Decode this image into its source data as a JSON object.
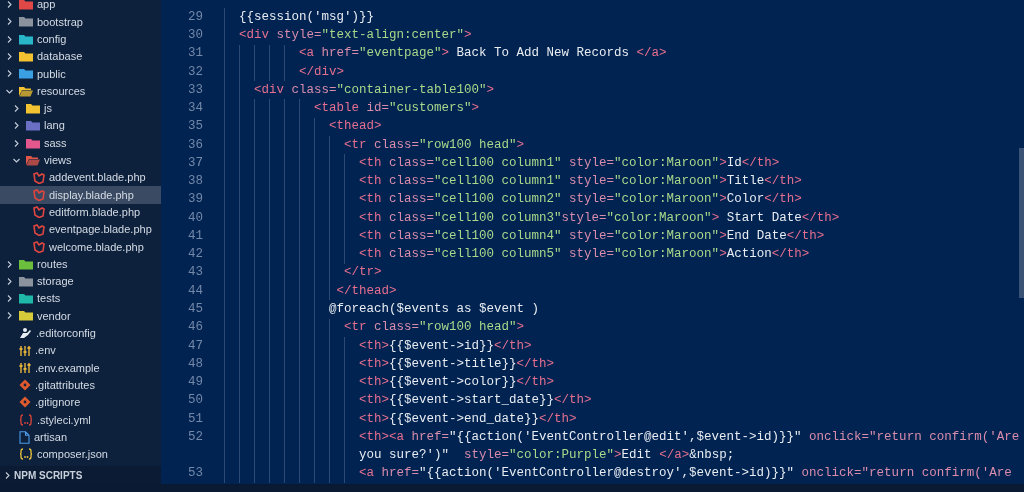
{
  "explorer": {
    "tree": [
      {
        "name": "app",
        "kind": "folder",
        "color": "#e04848",
        "expanded": false,
        "selected": false
      },
      {
        "name": "bootstrap",
        "kind": "folder",
        "color": "#8a939e",
        "expanded": false,
        "selected": false
      },
      {
        "name": "config",
        "kind": "folder",
        "color": "#29b6c9",
        "expanded": false,
        "selected": false
      },
      {
        "name": "database",
        "kind": "folder",
        "color": "#f2c230",
        "expanded": false,
        "selected": false
      },
      {
        "name": "public",
        "kind": "folder",
        "color": "#3b9fe3",
        "expanded": false,
        "selected": false
      },
      {
        "name": "resources",
        "kind": "folder",
        "color": "#f2c230",
        "expanded": true,
        "selected": false,
        "children": [
          {
            "name": "js",
            "kind": "folder",
            "color": "#f2c230",
            "expanded": false,
            "selected": false
          },
          {
            "name": "lang",
            "kind": "folder",
            "color": "#6b6fc4",
            "expanded": false,
            "selected": false
          },
          {
            "name": "sass",
            "kind": "folder",
            "color": "#e2578c",
            "expanded": false,
            "selected": false
          },
          {
            "name": "views",
            "kind": "folder",
            "color": "#e0574a",
            "expanded": true,
            "selected": false,
            "children": [
              {
                "name": "addevent.blade.php",
                "kind": "blade",
                "selected": false
              },
              {
                "name": "display.blade.php",
                "kind": "blade",
                "selected": true
              },
              {
                "name": "editform.blade.php",
                "kind": "blade",
                "selected": false
              },
              {
                "name": "eventpage.blade.php",
                "kind": "blade",
                "selected": false
              },
              {
                "name": "welcome.blade.php",
                "kind": "blade",
                "selected": false
              }
            ]
          }
        ]
      },
      {
        "name": "routes",
        "kind": "folder",
        "color": "#6cbf3c",
        "expanded": false,
        "selected": false
      },
      {
        "name": "storage",
        "kind": "folder",
        "color": "#8a939e",
        "expanded": false,
        "selected": false
      },
      {
        "name": "tests",
        "kind": "folder",
        "color": "#1fb8a8",
        "expanded": false,
        "selected": false
      },
      {
        "name": "vendor",
        "kind": "folder",
        "color": "#d6c93a",
        "expanded": false,
        "selected": false
      },
      {
        "name": ".editorconfig",
        "kind": "editorconfig",
        "selected": false
      },
      {
        "name": ".env",
        "kind": "env",
        "selected": false
      },
      {
        "name": ".env.example",
        "kind": "env",
        "selected": false
      },
      {
        "name": ".gitattributes",
        "kind": "git",
        "selected": false
      },
      {
        "name": ".gitignore",
        "kind": "git",
        "selected": false
      },
      {
        "name": ".styleci.yml",
        "kind": "yml",
        "selected": false
      },
      {
        "name": "artisan",
        "kind": "file",
        "selected": false
      },
      {
        "name": "composer.json",
        "kind": "json",
        "selected": false
      }
    ],
    "npm_scripts": {
      "title": "NPM SCRIPTS",
      "expanded": false
    }
  },
  "editor": {
    "rows": [
      {
        "number": "29",
        "tokens": [
          {
            "kind": "text",
            "text": "  {{session('msg')}}"
          }
        ]
      },
      {
        "number": "30",
        "tokens": [
          {
            "kind": "tag",
            "text": "  <div "
          },
          {
            "kind": "attr",
            "text": "style="
          },
          {
            "kind": "string",
            "text": "\"text-align:center\""
          },
          {
            "kind": "tag",
            "text": ">"
          }
        ]
      },
      {
        "number": "31",
        "tokens": [
          {
            "kind": "tag",
            "text": "          <a "
          },
          {
            "kind": "attr",
            "text": "href="
          },
          {
            "kind": "string",
            "text": "\"eventpage\""
          },
          {
            "kind": "tag",
            "text": ">"
          },
          {
            "kind": "text",
            "text": " Back To Add New Records "
          },
          {
            "kind": "tag",
            "text": "</a>"
          }
        ]
      },
      {
        "number": "32",
        "tokens": [
          {
            "kind": "tag",
            "text": "          </div>"
          }
        ]
      },
      {
        "number": "33",
        "tokens": [
          {
            "kind": "tag",
            "text": "    <div "
          },
          {
            "kind": "attr",
            "text": "class="
          },
          {
            "kind": "string",
            "text": "\"container-table100\""
          },
          {
            "kind": "tag",
            "text": ">"
          }
        ]
      },
      {
        "number": "34",
        "tokens": [
          {
            "kind": "tag",
            "text": "            <table "
          },
          {
            "kind": "attr",
            "text": "id="
          },
          {
            "kind": "string",
            "text": "\"customers\""
          },
          {
            "kind": "tag",
            "text": ">"
          }
        ]
      },
      {
        "number": "35",
        "tokens": [
          {
            "kind": "tag",
            "text": "              <thead>"
          }
        ]
      },
      {
        "number": "36",
        "tokens": [
          {
            "kind": "tag",
            "text": "                <tr "
          },
          {
            "kind": "attr",
            "text": "class="
          },
          {
            "kind": "string",
            "text": "\"row100 head\""
          },
          {
            "kind": "tag",
            "text": ">"
          }
        ]
      },
      {
        "number": "37",
        "tokens": [
          {
            "kind": "tag",
            "text": "                  <th "
          },
          {
            "kind": "attr",
            "text": "class="
          },
          {
            "kind": "string",
            "text": "\"cell100 column1\""
          },
          {
            "kind": "attr",
            "text": " style="
          },
          {
            "kind": "string",
            "text": "\"color:Maroon\""
          },
          {
            "kind": "tag",
            "text": ">"
          },
          {
            "kind": "text",
            "text": "Id"
          },
          {
            "kind": "tag",
            "text": "</th>"
          }
        ]
      },
      {
        "number": "38",
        "tokens": [
          {
            "kind": "tag",
            "text": "                  <th "
          },
          {
            "kind": "attr",
            "text": "class="
          },
          {
            "kind": "string",
            "text": "\"cell100 column1\""
          },
          {
            "kind": "attr",
            "text": " style="
          },
          {
            "kind": "string",
            "text": "\"color:Maroon\""
          },
          {
            "kind": "tag",
            "text": ">"
          },
          {
            "kind": "text",
            "text": "Title"
          },
          {
            "kind": "tag",
            "text": "</th>"
          }
        ]
      },
      {
        "number": "39",
        "tokens": [
          {
            "kind": "tag",
            "text": "                  <th "
          },
          {
            "kind": "attr",
            "text": "class="
          },
          {
            "kind": "string",
            "text": "\"cell100 column2\""
          },
          {
            "kind": "attr",
            "text": " style="
          },
          {
            "kind": "string",
            "text": "\"color:Maroon\""
          },
          {
            "kind": "tag",
            "text": ">"
          },
          {
            "kind": "text",
            "text": "Color"
          },
          {
            "kind": "tag",
            "text": "</th>"
          }
        ]
      },
      {
        "number": "40",
        "tokens": [
          {
            "kind": "tag",
            "text": "                  <th "
          },
          {
            "kind": "attr",
            "text": "class="
          },
          {
            "kind": "string",
            "text": "\"cell100 column3\""
          },
          {
            "kind": "attr",
            "text": "style="
          },
          {
            "kind": "string",
            "text": "\"color:Maroon\""
          },
          {
            "kind": "tag",
            "text": ">"
          },
          {
            "kind": "text",
            "text": " Start Date"
          },
          {
            "kind": "tag",
            "text": "</th>"
          }
        ]
      },
      {
        "number": "41",
        "tokens": [
          {
            "kind": "tag",
            "text": "                  <th "
          },
          {
            "kind": "attr",
            "text": "class="
          },
          {
            "kind": "string",
            "text": "\"cell100 column4\""
          },
          {
            "kind": "attr",
            "text": " style="
          },
          {
            "kind": "string",
            "text": "\"color:Maroon\""
          },
          {
            "kind": "tag",
            "text": ">"
          },
          {
            "kind": "text",
            "text": "End Date"
          },
          {
            "kind": "tag",
            "text": "</th>"
          }
        ]
      },
      {
        "number": "42",
        "tokens": [
          {
            "kind": "tag",
            "text": "                  <th "
          },
          {
            "kind": "attr",
            "text": "class="
          },
          {
            "kind": "string",
            "text": "\"cell100 column5\""
          },
          {
            "kind": "attr",
            "text": " style="
          },
          {
            "kind": "string",
            "text": "\"color:Maroon\""
          },
          {
            "kind": "tag",
            "text": ">"
          },
          {
            "kind": "text",
            "text": "Action"
          },
          {
            "kind": "tag",
            "text": "</th>"
          }
        ]
      },
      {
        "number": "43",
        "tokens": [
          {
            "kind": "tag",
            "text": "                </tr>"
          }
        ]
      },
      {
        "number": "44",
        "tokens": [
          {
            "kind": "tag",
            "text": "               </thead>"
          }
        ]
      },
      {
        "number": "45",
        "tokens": [
          {
            "kind": "text",
            "text": "              @foreach($events as $event )"
          }
        ]
      },
      {
        "number": "46",
        "tokens": [
          {
            "kind": "tag",
            "text": "                <tr "
          },
          {
            "kind": "attr",
            "text": "class="
          },
          {
            "kind": "string",
            "text": "\"row100 head\""
          },
          {
            "kind": "tag",
            "text": ">"
          }
        ]
      },
      {
        "number": "47",
        "tokens": [
          {
            "kind": "tag",
            "text": "                  <th>"
          },
          {
            "kind": "text",
            "text": "{{$event->id}}"
          },
          {
            "kind": "tag",
            "text": "</th>"
          }
        ]
      },
      {
        "number": "48",
        "tokens": [
          {
            "kind": "tag",
            "text": "                  <th>"
          },
          {
            "kind": "text",
            "text": "{{$event->title}}"
          },
          {
            "kind": "tag",
            "text": "</th>"
          }
        ]
      },
      {
        "number": "49",
        "tokens": [
          {
            "kind": "tag",
            "text": "                  <th>"
          },
          {
            "kind": "text",
            "text": "{{$event->color}}"
          },
          {
            "kind": "tag",
            "text": "</th>"
          }
        ]
      },
      {
        "number": "50",
        "tokens": [
          {
            "kind": "tag",
            "text": "                  <th>"
          },
          {
            "kind": "text",
            "text": "{{$event->start_date}}"
          },
          {
            "kind": "tag",
            "text": "</th>"
          }
        ]
      },
      {
        "number": "51",
        "tokens": [
          {
            "kind": "tag",
            "text": "                  <th>"
          },
          {
            "kind": "text",
            "text": "{{$event->end_date}}"
          },
          {
            "kind": "tag",
            "text": "</th>"
          }
        ]
      },
      {
        "number": "52",
        "tokens": [
          {
            "kind": "tag",
            "text": "                  <th><a "
          },
          {
            "kind": "attr",
            "text": "href="
          },
          {
            "kind": "text",
            "text": "\"{{action('EventController@edit',$event->id)}}\" "
          },
          {
            "kind": "attr",
            "text": "onclick=\"return confirm('Are"
          }
        ]
      },
      {
        "tokens": [
          {
            "kind": "text",
            "text": "                  you sure?')\"  "
          },
          {
            "kind": "attr",
            "text": "style="
          },
          {
            "kind": "string",
            "text": "\"color:Purple\""
          },
          {
            "kind": "tag",
            "text": ">"
          },
          {
            "kind": "text",
            "text": "Edit "
          },
          {
            "kind": "tag",
            "text": "</a>"
          },
          {
            "kind": "text",
            "text": "&nbsp;"
          }
        ]
      },
      {
        "number": "53",
        "tokens": [
          {
            "kind": "tag",
            "text": "                  <a "
          },
          {
            "kind": "attr",
            "text": "href="
          },
          {
            "kind": "text",
            "text": "\"{{action('EventController@destroy',$event->id)}}\" "
          },
          {
            "kind": "attr",
            "text": "onclick=\"return confirm('Are"
          }
        ]
      }
    ]
  }
}
